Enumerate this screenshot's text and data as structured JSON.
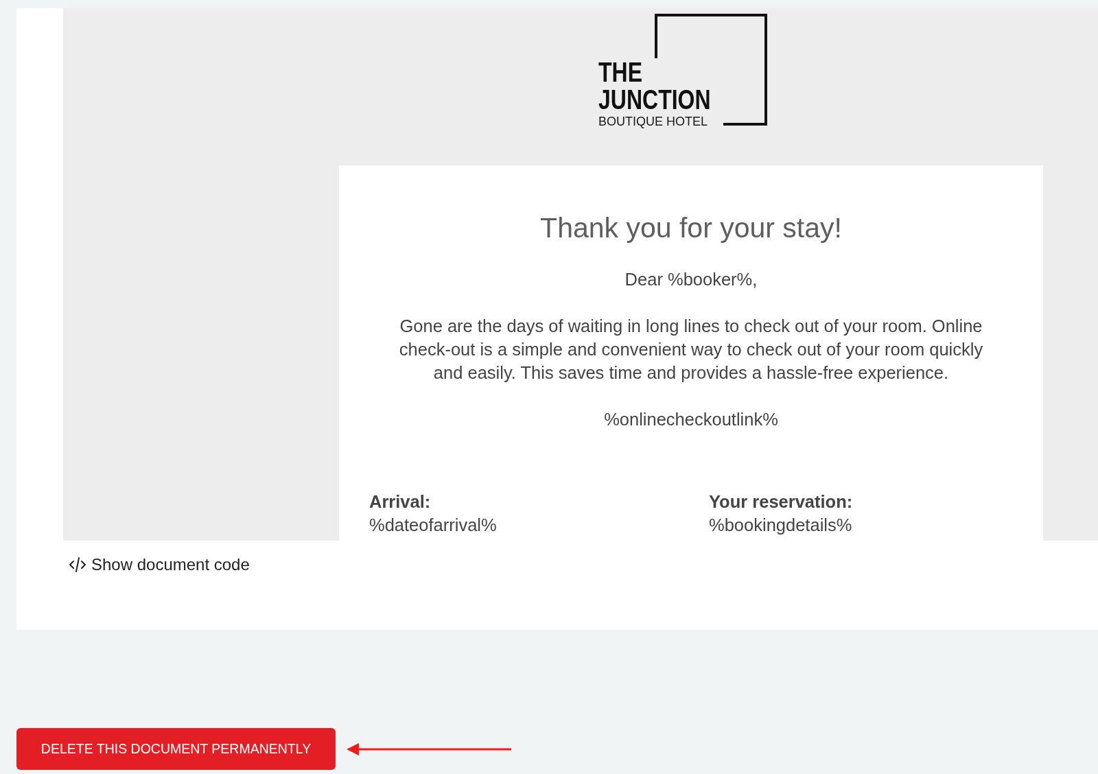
{
  "preview": {
    "logo": {
      "name_lines": [
        "THE",
        "JUNCTION"
      ],
      "tagline": "BOUTIQUE HOTEL"
    },
    "email": {
      "title": "Thank you for your stay!",
      "greeting": "Dear %booker%,",
      "body": "Gone are the days of waiting in long lines to check out of your room. Online check-out is a simple and convenient way to check out of your room quickly and easily. This saves time and provides a hassle-free experience.",
      "link_placeholder": "%onlinecheckoutlink%",
      "details": [
        {
          "label": "Arrival:",
          "value": "%dateofarrival%"
        },
        {
          "label": "Your reservation:",
          "value": "%bookingdetails%"
        }
      ]
    }
  },
  "code_toggle": {
    "label": "Show document code"
  },
  "delete_button": {
    "label": "DELETE THIS DOCUMENT PERMANENTLY"
  }
}
